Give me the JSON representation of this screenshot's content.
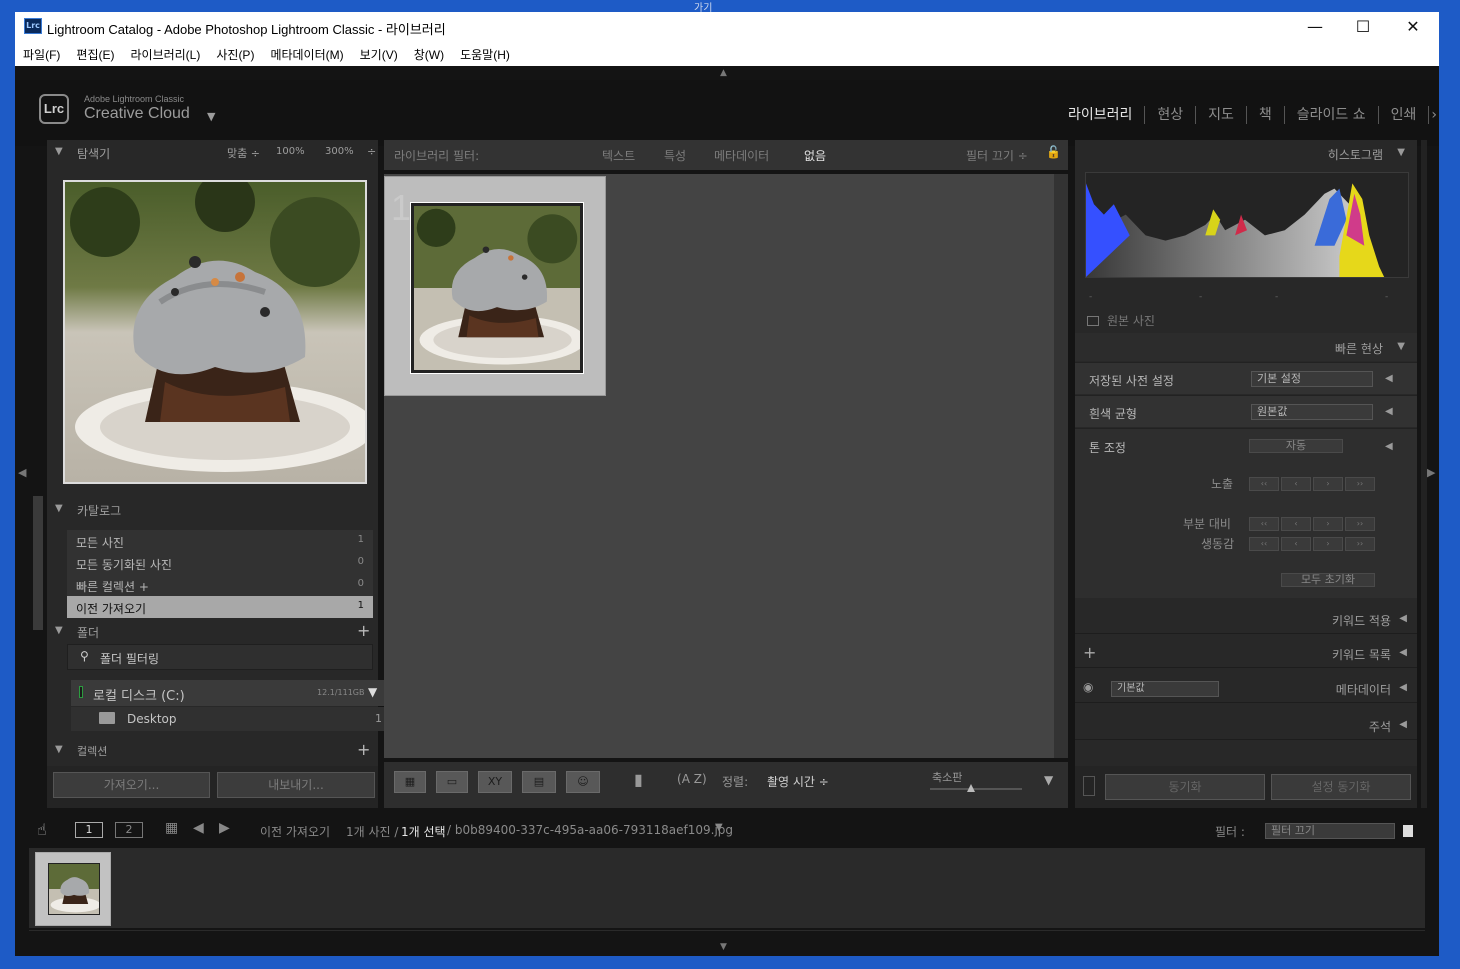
{
  "desktop": {
    "top_text": "가기"
  },
  "window": {
    "app_icon": "Lrc",
    "title": "Lightroom Catalog - Adobe Photoshop Lightroom Classic - 라이브러리",
    "controls": {
      "minimize": "—",
      "maximize": "☐",
      "close": "✕"
    }
  },
  "menu": [
    "파일(F)",
    "편집(E)",
    "라이브러리(L)",
    "사진(P)",
    "메타데이터(M)",
    "보기(V)",
    "창(W)",
    "도움말(H)"
  ],
  "identity": {
    "badge": "Lrc",
    "small": "Adobe Lightroom Classic",
    "big": "Creative Cloud",
    "caret": "▼"
  },
  "modules": [
    "라이브러리",
    "현상",
    "지도",
    "책",
    "슬라이드 쇼",
    "인쇄"
  ],
  "navigator": {
    "title": "탐색기",
    "fit": "맞춤 ÷",
    "zoom1": "100%",
    "zoom2": "300%",
    "zoom_stepper": "÷"
  },
  "catalog": {
    "title": "카탈로그",
    "rows": [
      {
        "label": "모든 사진",
        "count": "1"
      },
      {
        "label": "모든 동기화된 사진",
        "count": "0"
      },
      {
        "label": "빠른 컬렉션 +",
        "count": "0"
      },
      {
        "label": "이전 가져오기",
        "count": "1"
      }
    ]
  },
  "folders": {
    "title": "폴더",
    "add": "+",
    "filter_placeholder": "폴더 필터링",
    "disk": {
      "name": "로컬 디스크 (C:)",
      "space": "12.1/111GB",
      "caret": "▼"
    },
    "desktop": {
      "name": "Desktop",
      "count": "1"
    }
  },
  "collections": {
    "title": "컬렉션",
    "add": "+"
  },
  "left_buttons": {
    "import": "가져오기...",
    "export": "내보내기..."
  },
  "filterbar": {
    "label": "라이브러리 필터:",
    "text": "텍스트",
    "attribute": "특성",
    "metadata": "메타데이터",
    "none": "없음",
    "filters_off": "필터 끄기 ÷"
  },
  "grid": {
    "cell_number": "1"
  },
  "toolbar": {
    "sort_label": "정렬:",
    "sort_value": "촬영 시간 ÷",
    "thumb_label": "축소판",
    "az": "A Z",
    "thumb_level": 0.45
  },
  "histogram": {
    "title": "히스토그램",
    "original_photo": "원본 사진",
    "ticks": [
      "-",
      "-",
      "-",
      "-"
    ]
  },
  "quick_develop": {
    "title": "빠른 현상",
    "saved_preset_label": "저장된 사전 설정",
    "saved_preset_value": "기본 설정",
    "white_balance_label": "흰색 균형",
    "white_balance_value": "원본값",
    "tone_label": "톤 조정",
    "auto": "자동",
    "exposure": "노출",
    "clarity": "부분 대비",
    "vibrance": "생동감",
    "reset_all": "모두 초기화",
    "steppers": [
      "‹‹",
      "‹",
      "›",
      "››"
    ]
  },
  "right_sections": {
    "keywording": "키워드 적용",
    "keyword_list": "키워드 목록",
    "metadata": "메타데이터",
    "metadata_preset": "기본값",
    "comments": "주석"
  },
  "right_buttons": {
    "sync": "동기화",
    "sync_settings": "설정 동기화"
  },
  "filmbar": {
    "page1": "1",
    "page2": "2",
    "source": "이전 가져오기",
    "counts": "1개 사진 /",
    "selected": "1개 선택",
    "filename": "/ b0b89400-337c-495a-aa06-793118aef109.jpg",
    "filter_label": "필터 :",
    "filter_value": "필터 끄기"
  }
}
